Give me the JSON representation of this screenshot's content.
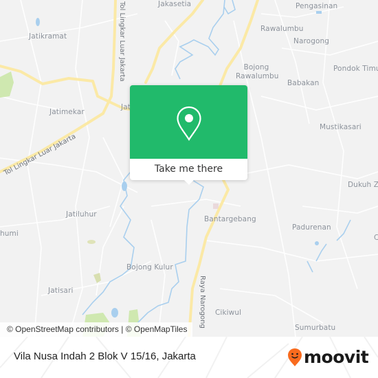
{
  "map": {
    "places": [
      {
        "name": "Jakasetia"
      },
      {
        "name": "Pengasinan"
      },
      {
        "name": "Jatikramat"
      },
      {
        "name": "Rawalumbu"
      },
      {
        "name": "Narogong"
      },
      {
        "name": "Bojong Rawalumbu"
      },
      {
        "name": "Pondok Timur"
      },
      {
        "name": "Babakan"
      },
      {
        "name": "Jatimekar"
      },
      {
        "name": "Jat"
      },
      {
        "name": "Mustikasari"
      },
      {
        "name": "Dukuh Z"
      },
      {
        "name": "Jatiluhur"
      },
      {
        "name": "Bantargebang"
      },
      {
        "name": "Padurenan"
      },
      {
        "name": "humi"
      },
      {
        "name": "Bojong Kulur"
      },
      {
        "name": "Jatisari"
      },
      {
        "name": "Cikiwul"
      },
      {
        "name": "Sumurbatu"
      },
      {
        "name": "C"
      }
    ],
    "roads": [
      {
        "name": "Tol Lingkar Luar Jakarta"
      },
      {
        "name": "Tol Lingkar Luar Jakarta"
      },
      {
        "name": "Raya Narogong"
      }
    ],
    "colors": {
      "background": "#f2f2f2",
      "major_road": "#fbe9a6",
      "water": "#a9cfee",
      "park": "#cfe8b0"
    }
  },
  "popup": {
    "icon": "map-pin-icon",
    "cta_label": "Take me there",
    "color": "#21ba6b"
  },
  "attribution": "© OpenStreetMap contributors | © OpenMapTiles",
  "footer": {
    "address": "Vila Nusa Indah 2 Blok V 15/16, Jakarta",
    "brand_name": "moovit",
    "brand_color": "#f96b1e"
  }
}
